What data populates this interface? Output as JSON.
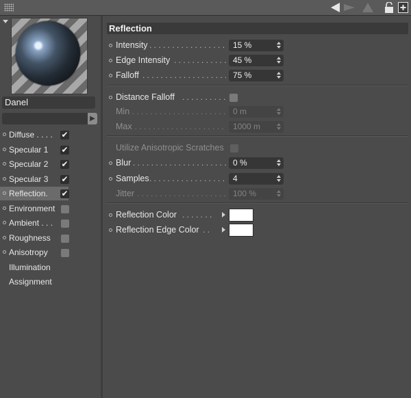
{
  "toolbar": {
    "icons": [
      "grip-icon",
      "back-arrow-icon",
      "forward-arrow-icon",
      "up-arrow-icon",
      "lock-icon",
      "new-window-icon"
    ]
  },
  "material": {
    "name": "Danel",
    "channels": [
      {
        "label": "Diffuse . . . .",
        "checked": true,
        "dot": true
      },
      {
        "label": "Specular 1",
        "checked": true,
        "dot": true
      },
      {
        "label": "Specular 2",
        "checked": true,
        "dot": true
      },
      {
        "label": "Specular 3",
        "checked": true,
        "dot": true
      },
      {
        "label": "Reflection.",
        "checked": true,
        "dot": true,
        "active": true
      },
      {
        "label": "Environment",
        "checked": false,
        "dot": true
      },
      {
        "label": "Ambient . . .",
        "checked": false,
        "dot": true
      },
      {
        "label": "Roughness",
        "checked": false,
        "dot": true
      },
      {
        "label": "Anisotropy",
        "checked": false,
        "dot": true
      },
      {
        "label": "Illumination",
        "dot": false
      },
      {
        "label": "Assignment",
        "dot": false
      }
    ]
  },
  "section": {
    "title": "Reflection",
    "intensity": {
      "label": "Intensity",
      "value": "15 %"
    },
    "edge_intensity": {
      "label": "Edge Intensity",
      "value": "45 %"
    },
    "falloff": {
      "label": "Falloff",
      "value": "75 %"
    },
    "distance_falloff": {
      "label": "Distance Falloff",
      "checked": false
    },
    "min": {
      "label": "Min",
      "value": "0 m"
    },
    "max": {
      "label": "Max",
      "value": "1000 m"
    },
    "anisotropic": {
      "label": "Utilize Anisotropic Scratches",
      "checked": false
    },
    "blur": {
      "label": "Blur",
      "value": "0 %"
    },
    "samples": {
      "label": "Samples",
      "value": "4"
    },
    "jitter": {
      "label": "Jitter",
      "value": "100 %"
    },
    "reflection_color": {
      "label": "Reflection Color",
      "color": "#ffffff"
    },
    "reflection_edge_color": {
      "label": "Reflection Edge Color",
      "color": "#ffffff"
    }
  }
}
